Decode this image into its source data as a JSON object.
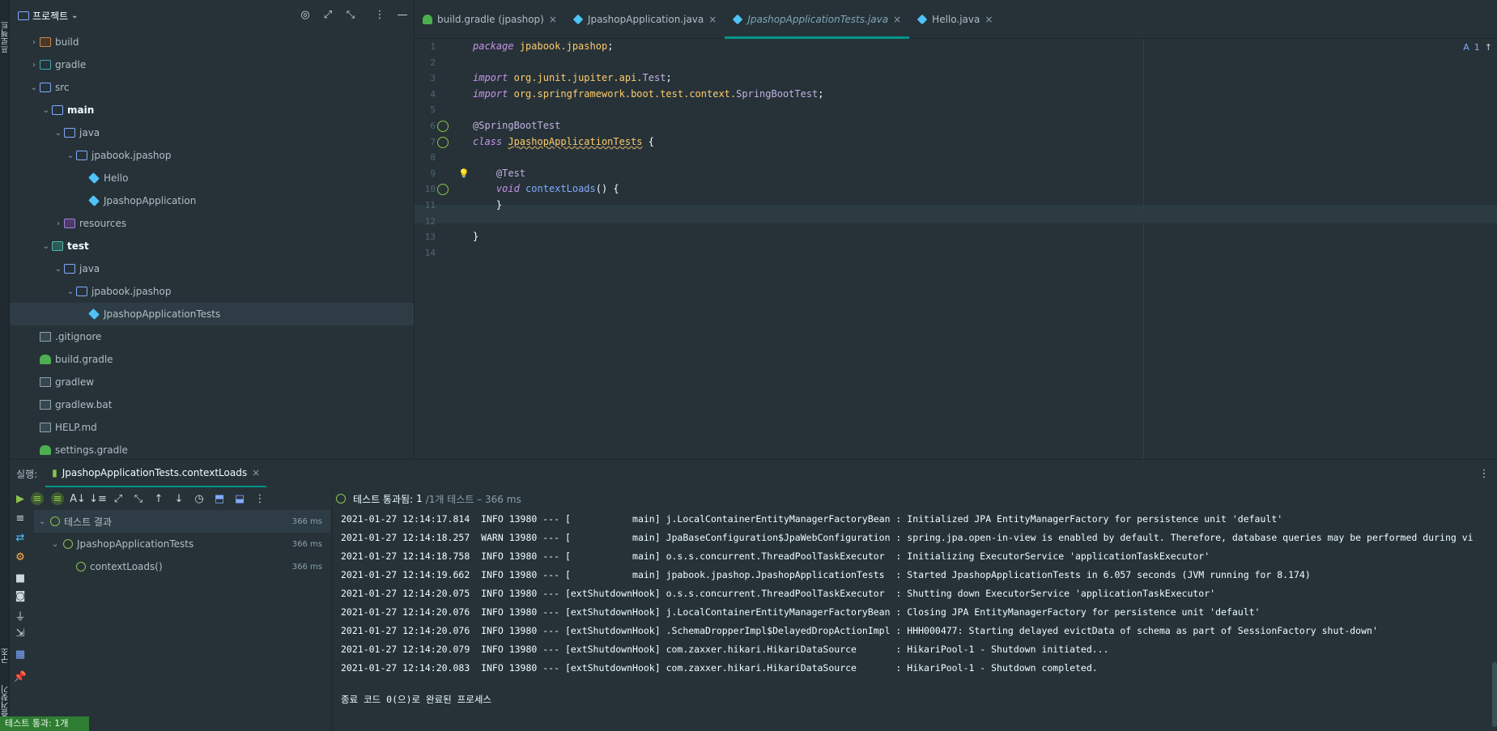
{
  "left_strip": {
    "top_label": "프로젝트",
    "bottom_label": "구조",
    "bottom_label2": "즐겨찾기"
  },
  "project_panel": {
    "title": "프로젝트",
    "tree": [
      {
        "label": "build",
        "depth": 1,
        "arrow": "›",
        "icon": "folder-orange"
      },
      {
        "label": "gradle",
        "depth": 1,
        "arrow": "›",
        "icon": "folder-teal"
      },
      {
        "label": "src",
        "depth": 1,
        "arrow": "⌄",
        "icon": "folder"
      },
      {
        "label": "main",
        "depth": 2,
        "arrow": "⌄",
        "icon": "folder",
        "bold": true
      },
      {
        "label": "java",
        "depth": 3,
        "arrow": "⌄",
        "icon": "folder"
      },
      {
        "label": "jpabook.jpashop",
        "depth": 4,
        "arrow": "⌄",
        "icon": "folder"
      },
      {
        "label": "Hello",
        "depth": 5,
        "arrow": "",
        "icon": "cube"
      },
      {
        "label": "JpashopApplication",
        "depth": 5,
        "arrow": "",
        "icon": "cube"
      },
      {
        "label": "resources",
        "depth": 3,
        "arrow": "›",
        "icon": "folder-purple"
      },
      {
        "label": "test",
        "depth": 2,
        "arrow": "⌄",
        "icon": "folder-green",
        "bold": true
      },
      {
        "label": "java",
        "depth": 3,
        "arrow": "⌄",
        "icon": "folder"
      },
      {
        "label": "jpabook.jpashop",
        "depth": 4,
        "arrow": "⌄",
        "icon": "folder"
      },
      {
        "label": "JpashopApplicationTests",
        "depth": 5,
        "arrow": "",
        "icon": "cube",
        "selected": true
      },
      {
        "label": ".gitignore",
        "depth": 1,
        "arrow": "",
        "icon": "file"
      },
      {
        "label": "build.gradle",
        "depth": 1,
        "arrow": "",
        "icon": "elephant"
      },
      {
        "label": "gradlew",
        "depth": 1,
        "arrow": "",
        "icon": "file"
      },
      {
        "label": "gradlew.bat",
        "depth": 1,
        "arrow": "",
        "icon": "file"
      },
      {
        "label": "HELP.md",
        "depth": 1,
        "arrow": "",
        "icon": "file"
      },
      {
        "label": "settings.gradle",
        "depth": 1,
        "arrow": "",
        "icon": "elephant"
      }
    ]
  },
  "tabs": [
    {
      "label": "build.gradle (jpashop)",
      "icon": "elephant",
      "active": false
    },
    {
      "label": "JpashopApplication.java",
      "icon": "cube",
      "active": false
    },
    {
      "label": "JpashopApplicationTests.java",
      "icon": "cube",
      "active": true
    },
    {
      "label": "Hello.java",
      "icon": "cube",
      "active": false
    }
  ],
  "editor": {
    "inspection_count": "1",
    "line_numbers": [
      "1",
      "2",
      "3",
      "4",
      "5",
      "6",
      "7",
      "8",
      "9",
      "10",
      "11",
      "12",
      "13",
      "14"
    ],
    "lines": [
      {
        "n": 1,
        "parts": [
          [
            "kw",
            "package"
          ],
          [
            "txt",
            " "
          ],
          [
            "pkg",
            "jpabook.jpashop"
          ],
          [
            "txt",
            ";"
          ]
        ]
      },
      {
        "n": 2,
        "parts": []
      },
      {
        "n": 3,
        "parts": [
          [
            "kw",
            "import"
          ],
          [
            "txt",
            " "
          ],
          [
            "pkg",
            "org.junit.jupiter.api."
          ],
          [
            "ann",
            "Test"
          ],
          [
            "txt",
            ";"
          ]
        ]
      },
      {
        "n": 4,
        "parts": [
          [
            "kw",
            "import"
          ],
          [
            "txt",
            " "
          ],
          [
            "pkg",
            "org.springframework.boot.test.context."
          ],
          [
            "ann",
            "SpringBootTest"
          ],
          [
            "txt",
            ";"
          ]
        ]
      },
      {
        "n": 5,
        "parts": []
      },
      {
        "n": 6,
        "parts": [
          [
            "ann",
            "@SpringBootTest"
          ]
        ]
      },
      {
        "n": 7,
        "parts": [
          [
            "kw",
            "class"
          ],
          [
            "txt",
            " "
          ],
          [
            "cls",
            "JpashopApplicationTests"
          ],
          [
            "txt",
            " {"
          ]
        ]
      },
      {
        "n": 8,
        "parts": []
      },
      {
        "n": 9,
        "parts": [
          [
            "txt",
            "    "
          ],
          [
            "ann",
            "@Test"
          ]
        ]
      },
      {
        "n": 10,
        "parts": [
          [
            "txt",
            "    "
          ],
          [
            "kw",
            "void"
          ],
          [
            "txt",
            " "
          ],
          [
            "fn",
            "contextLoads"
          ],
          [
            "txt",
            "() {"
          ]
        ]
      },
      {
        "n": 11,
        "parts": [
          [
            "txt",
            "    }"
          ]
        ]
      },
      {
        "n": 12,
        "parts": []
      },
      {
        "n": 13,
        "parts": [
          [
            "txt",
            "}"
          ]
        ]
      },
      {
        "n": 14,
        "parts": []
      }
    ]
  },
  "run_panel": {
    "label": "실행:",
    "tab_label": "JpashopApplicationTests.contextLoads",
    "status": "테스트 통과됨:",
    "status_count": "1",
    "status_detail": "/1개 테스트 – 366 ms",
    "results": [
      {
        "label": "테스트 결과",
        "time": "366 ms",
        "depth": 0,
        "selected": true,
        "arrow": "⌄"
      },
      {
        "label": "JpashopApplicationTests",
        "time": "366 ms",
        "depth": 1,
        "arrow": "⌄"
      },
      {
        "label": "contextLoads()",
        "time": "366 ms",
        "depth": 2,
        "arrow": ""
      }
    ],
    "log_lines": [
      "2021-01-27 12:14:17.814  INFO 13980 --- [           main] j.LocalContainerEntityManagerFactoryBean : Initialized JPA EntityManagerFactory for persistence unit 'default'",
      "2021-01-27 12:14:18.257  WARN 13980 --- [           main] JpaBaseConfiguration$JpaWebConfiguration : spring.jpa.open-in-view is enabled by default. Therefore, database queries may be performed during vi",
      "2021-01-27 12:14:18.758  INFO 13980 --- [           main] o.s.s.concurrent.ThreadPoolTaskExecutor  : Initializing ExecutorService 'applicationTaskExecutor'",
      "2021-01-27 12:14:19.662  INFO 13980 --- [           main] jpabook.jpashop.JpashopApplicationTests  : Started JpashopApplicationTests in 6.057 seconds (JVM running for 8.174)",
      "2021-01-27 12:14:20.075  INFO 13980 --- [extShutdownHook] o.s.s.concurrent.ThreadPoolTaskExecutor  : Shutting down ExecutorService 'applicationTaskExecutor'",
      "2021-01-27 12:14:20.076  INFO 13980 --- [extShutdownHook] j.LocalContainerEntityManagerFactoryBean : Closing JPA EntityManagerFactory for persistence unit 'default'",
      "2021-01-27 12:14:20.076  INFO 13980 --- [extShutdownHook] .SchemaDropperImpl$DelayedDropActionImpl : HHH000477: Starting delayed evictData of schema as part of SessionFactory shut-down'",
      "2021-01-27 12:14:20.079  INFO 13980 --- [extShutdownHook] com.zaxxer.hikari.HikariDataSource       : HikariPool-1 - Shutdown initiated...",
      "2021-01-27 12:14:20.083  INFO 13980 --- [extShutdownHook] com.zaxxer.hikari.HikariDataSource       : HikariPool-1 - Shutdown completed."
    ],
    "exit_message": "종료 코드 0(으)로 완료된 프로세스"
  },
  "status_badge": "테스트 통과: 1개"
}
